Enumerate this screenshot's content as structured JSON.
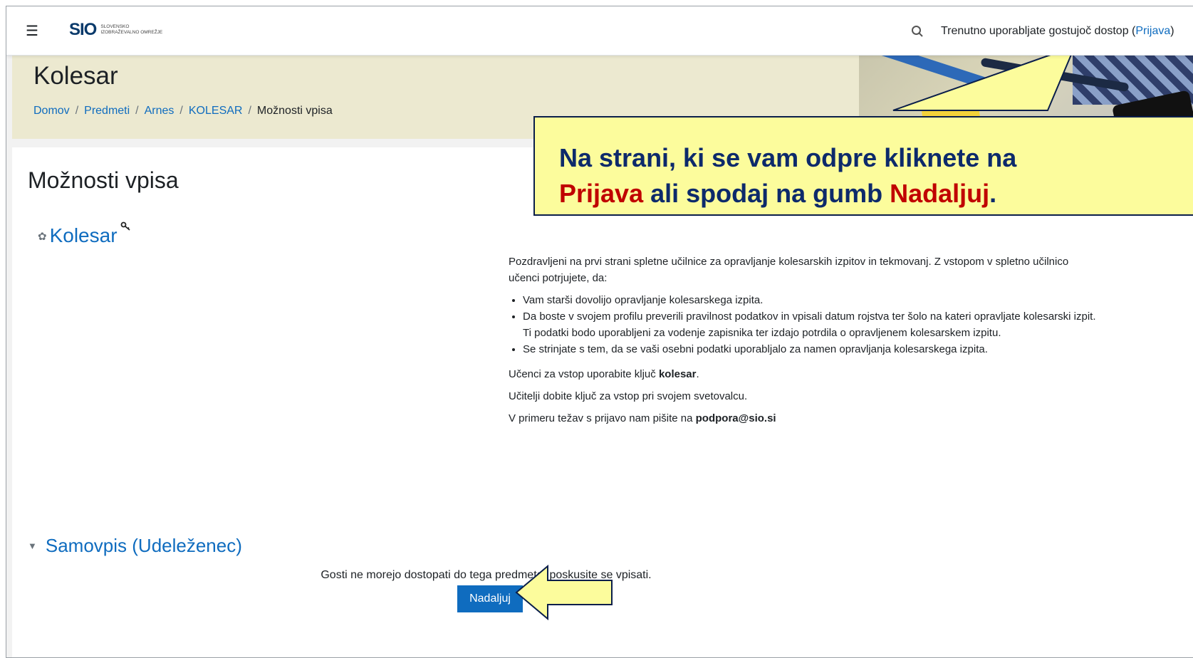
{
  "navbar": {
    "logo_mark": "SIO",
    "logo_line1": "SLOVENSKO",
    "logo_line2": "IZOBRAŽEVALNO OMREŽJE",
    "guest_text": "Trenutno uporabljate gostujoč dostop (",
    "login_link": "Prijava",
    "guest_close": ")"
  },
  "header": {
    "title": "Kolesar",
    "breadcrumb": [
      "Domov",
      "Predmeti",
      "Arnes",
      "KOLESAR",
      "Možnosti vpisa"
    ]
  },
  "main": {
    "title": "Možnosti vpisa",
    "course_name": "Kolesar",
    "summary_intro": "Pozdravljeni na prvi strani spletne učilnice za opravljanje kolesarskih izpitov in tekmovanj. Z vstopom v spletno učilnico učenci potrjujete, da:",
    "summary_items": [
      "Vam starši dovolijo opravljanje kolesarskega izpita.",
      "Da boste v svojem profilu preverili pravilnost podatkov in vpisali datum rojstva ter šolo na kateri opravljate kolesarski izpit. Ti podatki bodo uporabljeni za vodenje zapisnika ter izdajo potrdila o opravljenem kolesarskem izpitu.",
      "Se strinjate s tem, da se vaši osebni podatki uporabljalo za namen opravljanja kolesarskega izpita."
    ],
    "key_text_pre": "Učenci za vstop uporabite ključ ",
    "key_word": "kolesar",
    "key_text_post": ".",
    "teachers_text": "Učitelji dobite ključ za vstop pri svojem svetovalcu.",
    "support_pre": "V primeru težav s prijavo nam pišite na ",
    "support_email": "podpora@sio.si",
    "section_title": "Samovpis (Udeleženec)",
    "guest_note": "Gosti ne morejo dostopati do tega predmeta, poskusite se vpisati.",
    "continue_button": "Nadaljuj"
  },
  "callout": {
    "line1": "Na strani, ki se vam odpre kliknete na",
    "line2_red1": "Prijava",
    "line2_mid": " ali spodaj na gumb ",
    "line2_red2": "Nadaljuj",
    "line2_end": "."
  },
  "colors": {
    "link": "#0f6cbf",
    "callout_bg": "#fcfc9c",
    "callout_text": "#0d2a6b",
    "callout_red": "#c00000",
    "header_band": "#ece9d0"
  },
  "icons": [
    "hamburger-icon",
    "search-icon",
    "course-icon",
    "key-icon",
    "collapse-triangle-icon"
  ]
}
